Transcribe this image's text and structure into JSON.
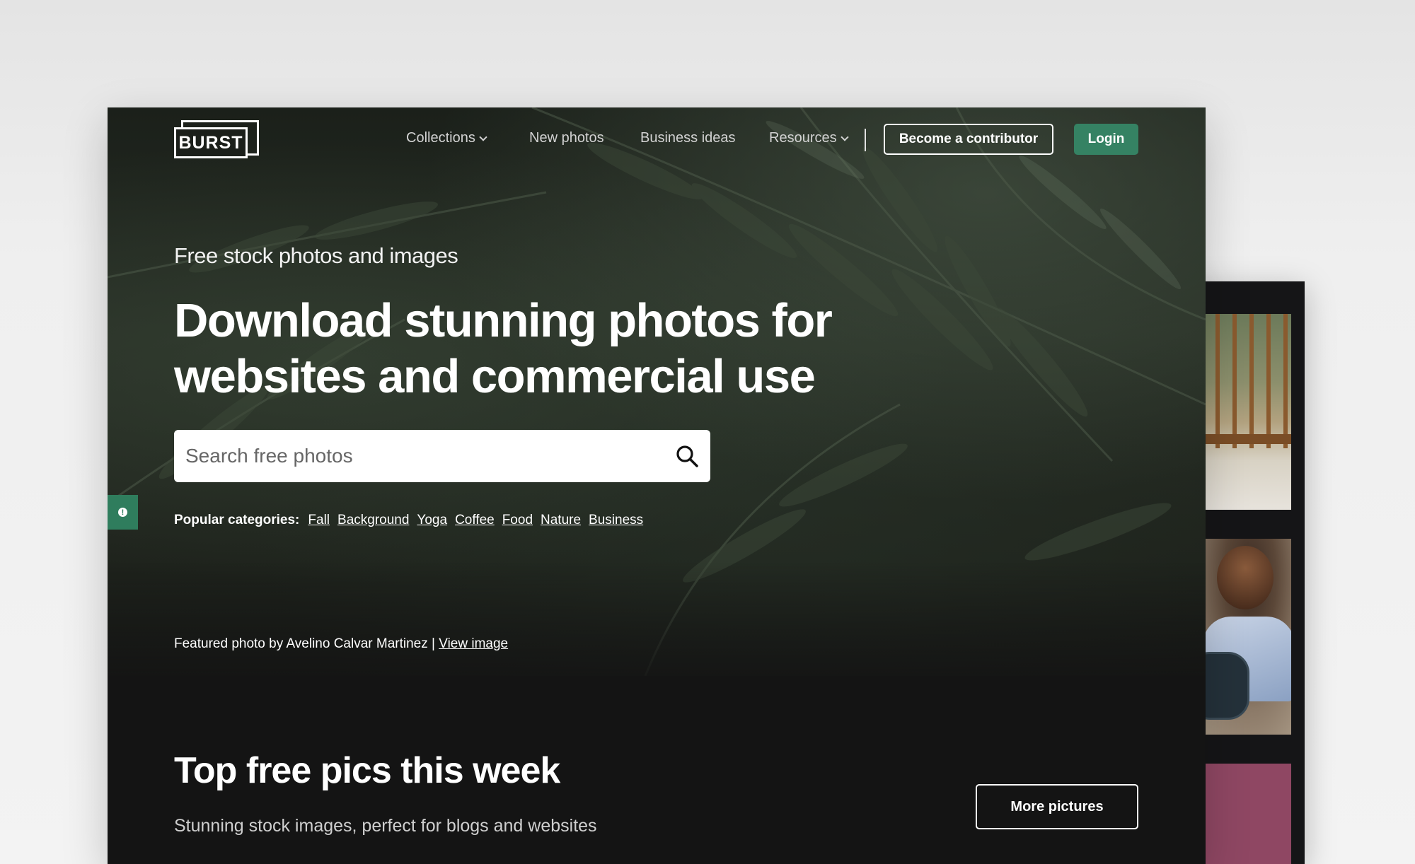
{
  "nav": {
    "logo_text": "BURST",
    "items": [
      {
        "label": "Collections",
        "has_dropdown": true
      },
      {
        "label": "New photos",
        "has_dropdown": false
      },
      {
        "label": "Business ideas",
        "has_dropdown": false
      },
      {
        "label": "Resources",
        "has_dropdown": true
      }
    ],
    "contributor_label": "Become a contributor",
    "login_label": "Login"
  },
  "hero": {
    "kicker": "Free stock photos and images",
    "headline": "Download stunning photos for websites and commercial use",
    "search_placeholder": "Search free photos",
    "search_icon": "search-icon",
    "popular_label": "Popular categories:",
    "categories": [
      "Fall",
      "Background",
      "Yoga",
      "Coffee",
      "Food",
      "Nature",
      "Business"
    ],
    "featured_prefix": "Featured photo by Avelino Calvar Martinez |",
    "featured_link": "View image"
  },
  "section": {
    "title": "Top free pics this week",
    "subtitle": "Stunning stock images, perfect for blogs and websites",
    "more_label": "More pictures"
  },
  "colors": {
    "brand_green": "#358263",
    "page_dark": "#141414",
    "backdrop": "#efefef"
  }
}
